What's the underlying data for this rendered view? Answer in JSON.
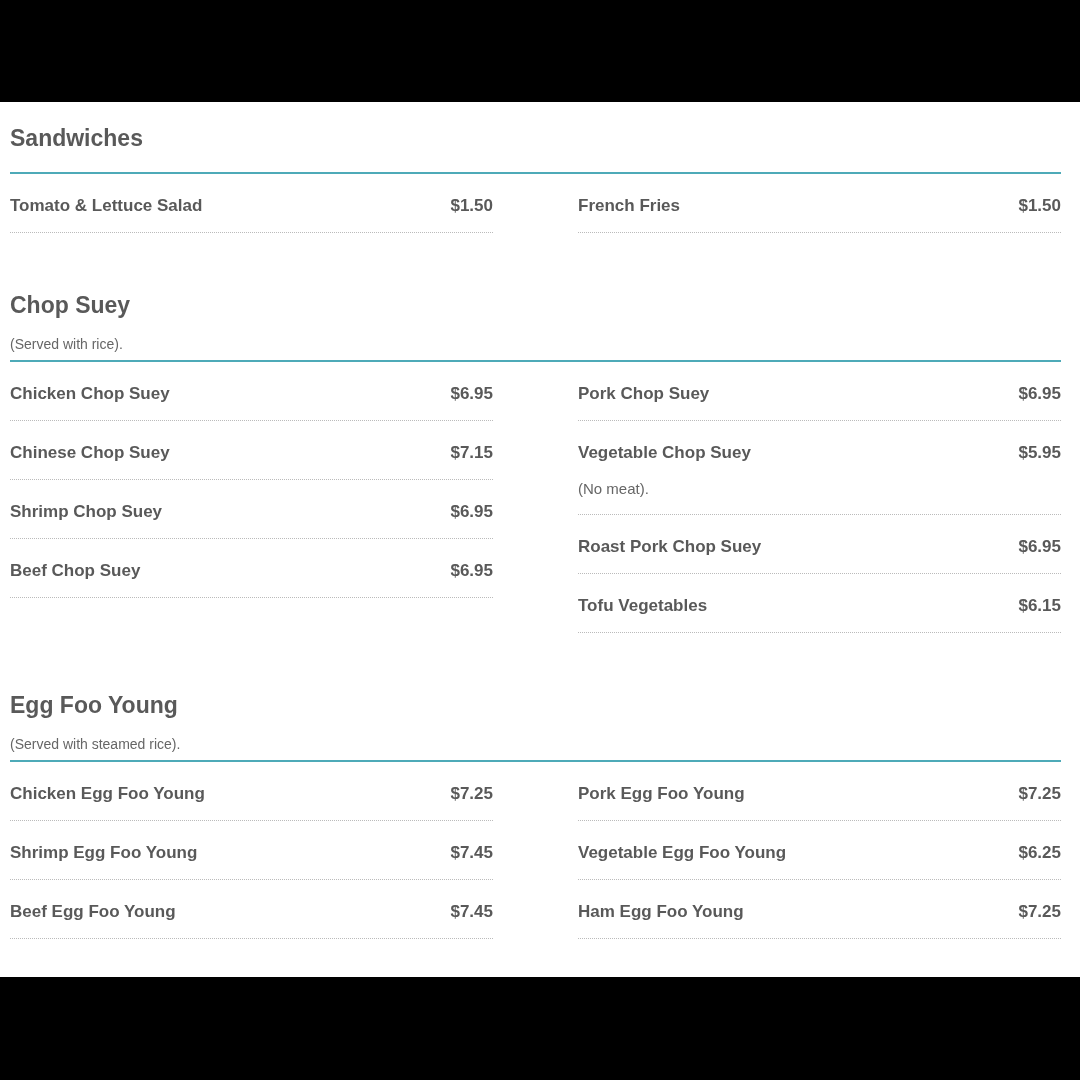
{
  "sections": [
    {
      "title": "Sandwiches",
      "columns": [
        [
          {
            "name": "Tomato & Lettuce Salad",
            "price": "$1.50"
          }
        ],
        [
          {
            "name": "French Fries",
            "price": "$1.50"
          }
        ]
      ]
    },
    {
      "title": "Chop Suey",
      "note": "(Served with rice).",
      "columns": [
        [
          {
            "name": "Chicken Chop Suey",
            "price": "$6.95"
          },
          {
            "name": "Chinese Chop Suey",
            "price": "$7.15"
          },
          {
            "name": "Shrimp Chop Suey",
            "price": "$6.95"
          },
          {
            "name": "Beef Chop Suey",
            "price": "$6.95"
          }
        ],
        [
          {
            "name": "Pork Chop Suey",
            "price": "$6.95"
          },
          {
            "name": "Vegetable Chop Suey",
            "price": "$5.95",
            "note": "(No meat)."
          },
          {
            "name": "Roast Pork Chop Suey",
            "price": "$6.95"
          },
          {
            "name": "Tofu Vegetables",
            "price": "$6.15"
          }
        ]
      ]
    },
    {
      "title": "Egg Foo Young",
      "note": "(Served with steamed rice).",
      "columns": [
        [
          {
            "name": "Chicken Egg Foo Young",
            "price": "$7.25"
          },
          {
            "name": "Shrimp Egg Foo Young",
            "price": "$7.45"
          },
          {
            "name": "Beef Egg Foo Young",
            "price": "$7.45"
          }
        ],
        [
          {
            "name": "Pork Egg Foo Young",
            "price": "$7.25"
          },
          {
            "name": "Vegetable Egg Foo Young",
            "price": "$6.25"
          },
          {
            "name": "Ham Egg Foo Young",
            "price": "$7.25"
          }
        ]
      ]
    }
  ]
}
